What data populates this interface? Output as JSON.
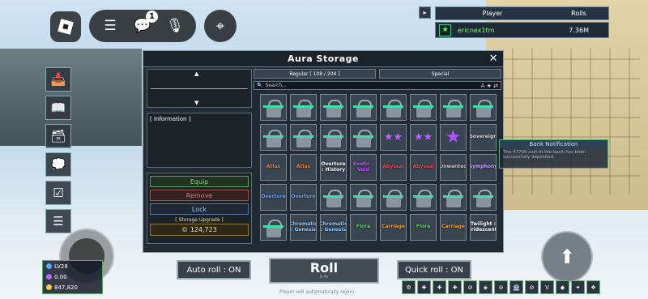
{
  "colors": {
    "window_bg": "#222b33",
    "accent_green": "#3ce0a6",
    "star_purple": "#b450ff"
  },
  "topbar": {
    "roblox_icon": "roblox-logo-icon",
    "menu_icon": "hamburger-icon",
    "chat_icon": "chat-icon",
    "chat_badge": "1",
    "mic_icon": "mic-muted-icon",
    "target_icon": "crosshair-icon"
  },
  "leaderboard": {
    "col_player": "Player",
    "col_rolls": "Rolls",
    "rows": [
      {
        "name": "ericnex1tm",
        "rolls": "7.36M"
      }
    ]
  },
  "aura_storage": {
    "title": "Aura Storage",
    "tab_regular": "Regular [ 108 / 204 ]",
    "tab_special": "Special",
    "search_placeholder": "Search...",
    "info_label": "[ Information ]",
    "equip_label": "Equip",
    "remove_label": "Remove",
    "lock_label": "Lock",
    "storage_upgrade_label": "[ Storage Upgrade ]",
    "coins": "124,723",
    "grid": [
      {
        "type": "locked"
      },
      {
        "type": "locked"
      },
      {
        "type": "locked"
      },
      {
        "type": "locked"
      },
      {
        "type": "locked"
      },
      {
        "type": "locked"
      },
      {
        "type": "locked"
      },
      {
        "type": "locked"
      },
      {
        "type": "locked"
      },
      {
        "type": "locked"
      },
      {
        "type": "locked"
      },
      {
        "type": "locked"
      },
      {
        "type": "stars",
        "label": "★★"
      },
      {
        "type": "stars",
        "label": "★★"
      },
      {
        "type": "bigstar",
        "label": "★"
      },
      {
        "type": "text",
        "label": "Sovereign",
        "color": "#dddddd"
      },
      {
        "type": "text",
        "label": "Atlas",
        "color": "#e0824a"
      },
      {
        "type": "text",
        "label": "Atlas",
        "color": "#e0824a"
      },
      {
        "type": "text",
        "label": "Overture : History",
        "color": "#ffffff"
      },
      {
        "type": "text",
        "label": "Exotic : Void",
        "color": "#c45cff"
      },
      {
        "type": "text",
        "label": "Abyssal",
        "color": "#e05060"
      },
      {
        "type": "text",
        "label": "Abyssal",
        "color": "#e05060"
      },
      {
        "type": "text",
        "label": "Unwanted",
        "color": "#cccccc"
      },
      {
        "type": "text",
        "label": "Symphony",
        "color": "#c9a8ff"
      },
      {
        "type": "text",
        "label": "Overture",
        "color": "#6aa8ff"
      },
      {
        "type": "text",
        "label": "Overture",
        "color": "#6aa8ff"
      },
      {
        "type": "locked"
      },
      {
        "type": "locked"
      },
      {
        "type": "locked"
      },
      {
        "type": "locked"
      },
      {
        "type": "locked"
      },
      {
        "type": "locked"
      },
      {
        "type": "locked"
      },
      {
        "type": "text",
        "label": "Chromatic : Genesis",
        "color": "#8fc7ff"
      },
      {
        "type": "text",
        "label": "Chromatic : Genesis",
        "color": "#8fc7ff"
      },
      {
        "type": "text",
        "label": "Flora",
        "color": "#60d060"
      },
      {
        "type": "text",
        "label": "Carriage",
        "color": "#e0a050"
      },
      {
        "type": "text",
        "label": "Flora",
        "color": "#60d060"
      },
      {
        "type": "text",
        "label": "Carriage",
        "color": "#e0a050"
      },
      {
        "type": "text",
        "label": "Twilight : Iridescent",
        "color": "#ffffff"
      }
    ]
  },
  "bank_notification": {
    "title": "Bank Notification",
    "message": "The 47700 coin in the bank has been successfully deposited."
  },
  "controls": {
    "auto_roll": "Auto roll : ON",
    "roll": "Roll",
    "roll_sub": "9.4s",
    "quick_roll": "Quick roll : ON",
    "rejoin_note": "Player will automatically rejoin."
  },
  "stats": {
    "level": "LV28",
    "gems": "0.00",
    "coins": "847,820"
  }
}
